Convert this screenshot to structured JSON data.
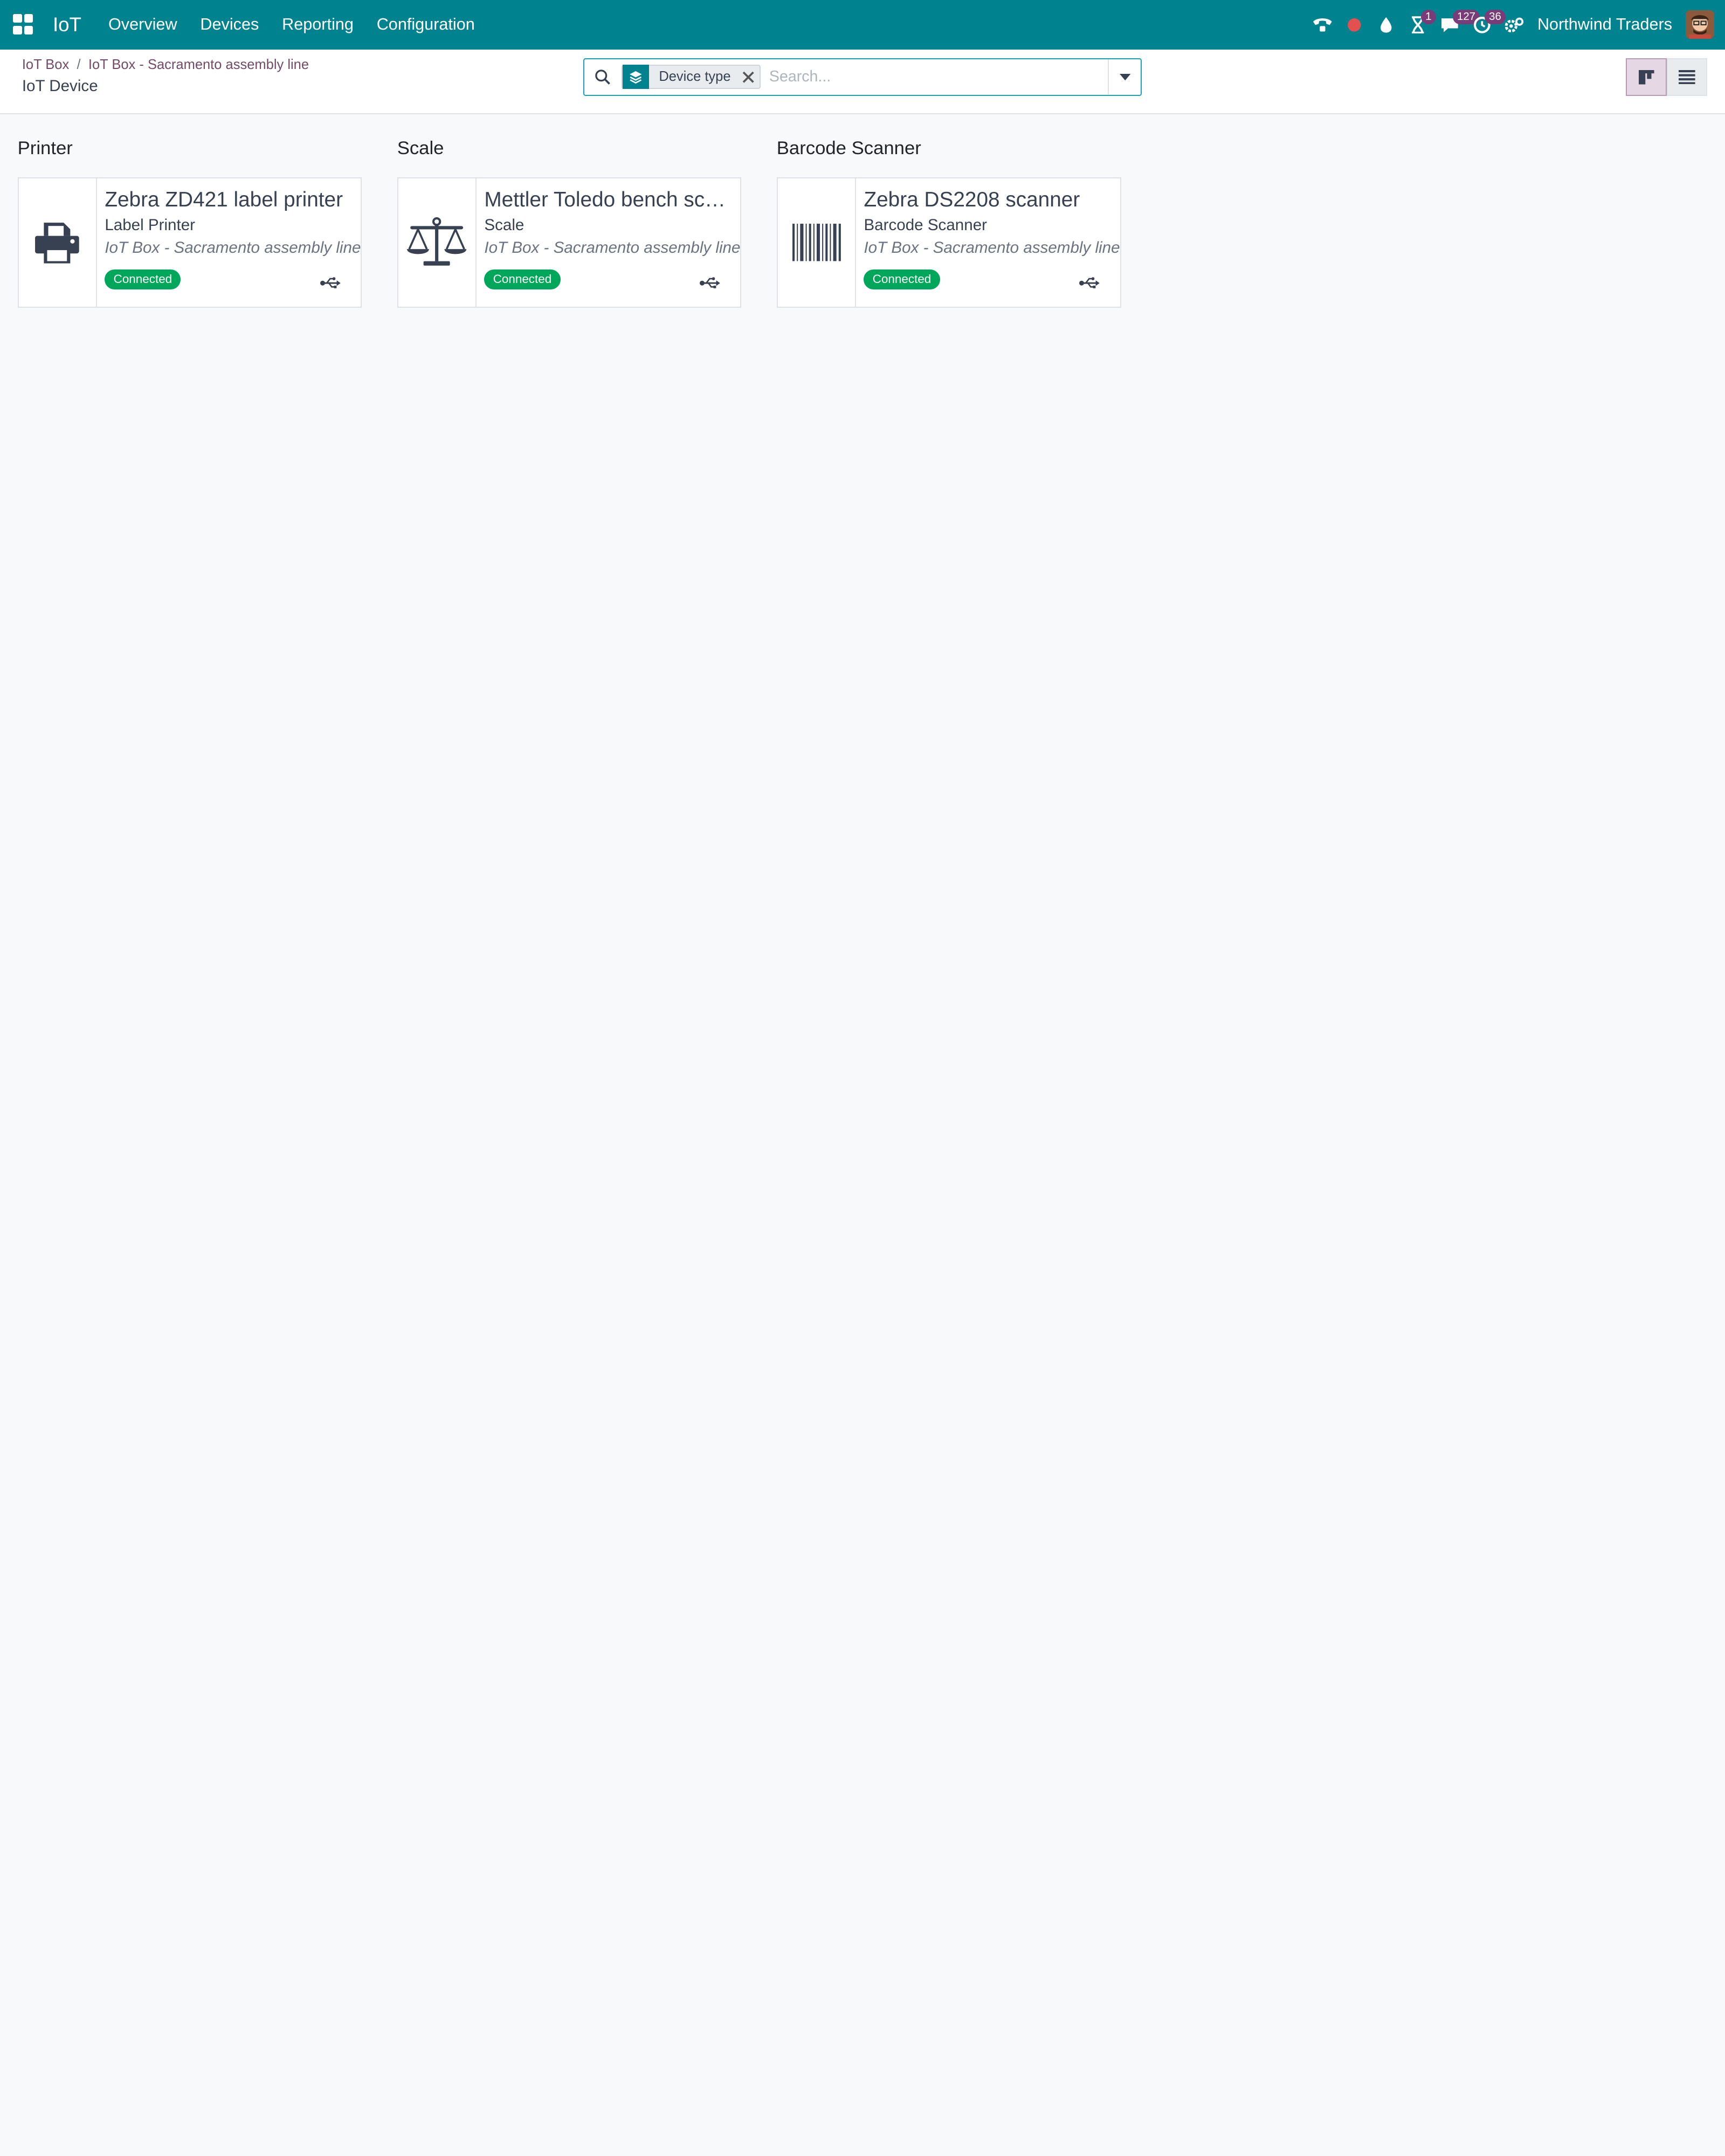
{
  "navbar": {
    "brand": "IoT",
    "menu": [
      "Overview",
      "Devices",
      "Reporting",
      "Configuration"
    ],
    "badges": {
      "activities": "1",
      "messages": "127",
      "timer": "36"
    },
    "company": "Northwind Traders",
    "colors": {
      "bar": "#00838f",
      "badge": "#7a3b79",
      "recording_dot": "#e25050"
    }
  },
  "breadcrumb": {
    "items": [
      "IoT Box",
      "IoT Box - Sacramento assembly line"
    ],
    "separator": "/",
    "current": "IoT Device"
  },
  "search": {
    "facet_label": "Device type",
    "placeholder": "Search..."
  },
  "views": {
    "active": "kanban",
    "options": [
      "kanban",
      "list"
    ]
  },
  "groups": [
    {
      "title": "Printer",
      "cards": [
        {
          "name": "Zebra ZD421 label printer",
          "type": "Label Printer",
          "iot_box": "IoT Box - Sacramento assembly line",
          "status": "Connected",
          "icon": "printer-icon",
          "connection_icon": "usb-icon"
        }
      ]
    },
    {
      "title": "Scale",
      "cards": [
        {
          "name": "Mettler Toledo bench scale",
          "type": "Scale",
          "iot_box": "IoT Box - Sacramento assembly line",
          "status": "Connected",
          "icon": "scale-icon",
          "connection_icon": "usb-icon"
        }
      ]
    },
    {
      "title": "Barcode Scanner",
      "cards": [
        {
          "name": "Zebra DS2208 scanner",
          "type": "Barcode Scanner",
          "iot_box": "IoT Box - Sacramento assembly line",
          "status": "Connected",
          "icon": "barcode-icon",
          "connection_icon": "usb-icon"
        }
      ]
    }
  ],
  "status_color": "#00a65a"
}
